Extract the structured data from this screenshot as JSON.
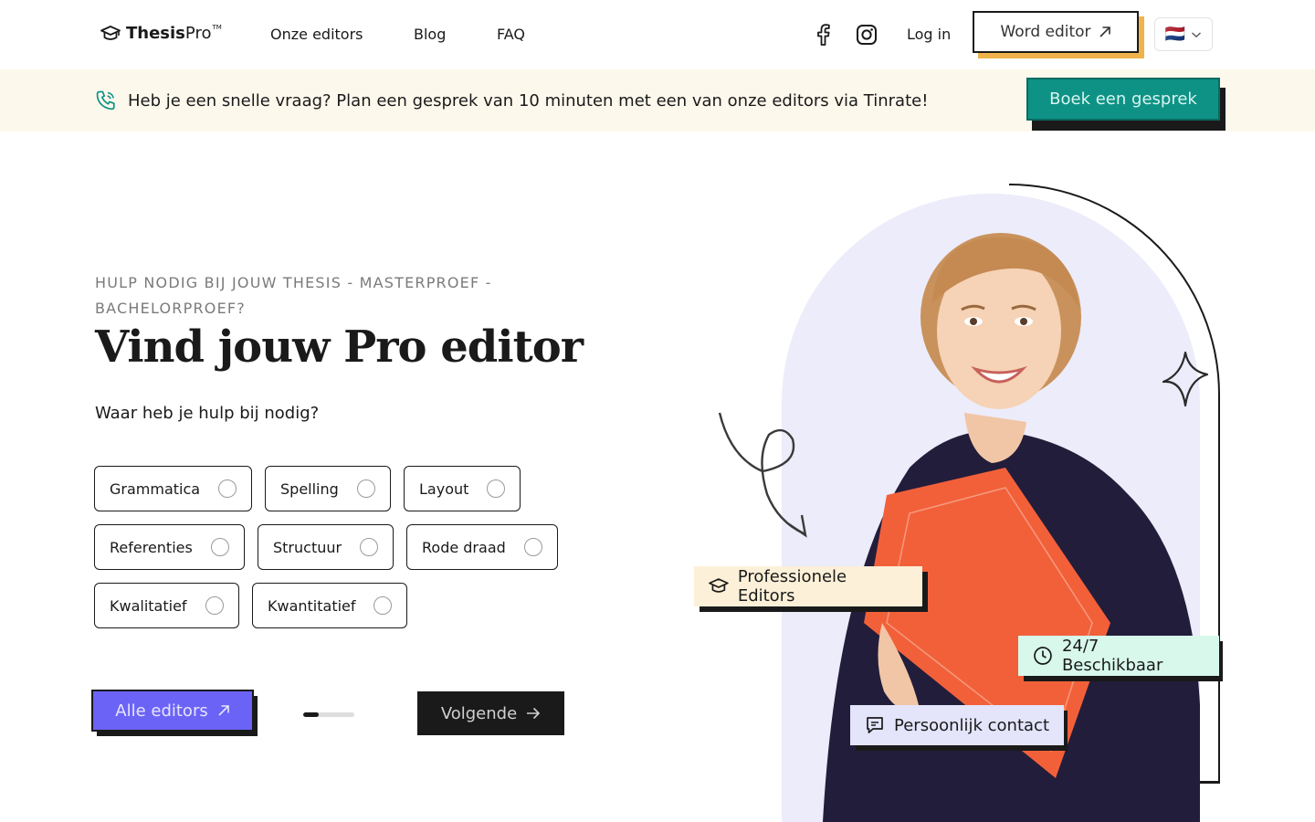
{
  "header": {
    "logo": {
      "brand_bold": "Thesis",
      "brand_light": "Pro",
      "trademark": "TM",
      "icon": "graduation-cap-icon"
    },
    "nav": [
      "Onze editors",
      "Blog",
      "FAQ"
    ],
    "social": [
      "facebook-icon",
      "instagram-icon"
    ],
    "login_label": "Log in",
    "word_editor_label": "Word editor",
    "language_flag": "🇳🇱"
  },
  "banner": {
    "icon": "phone-icon",
    "text": "Heb je een snelle vraag? Plan een gesprek van 10 minuten met een van onze editors via Tinrate!",
    "button_label": "Boek een gesprek"
  },
  "hero": {
    "eyebrow": "HULP NODIG BIJ JOUW THESIS - MASTERPROEF - BACHELORPROEF?",
    "title": "Vind jouw Pro editor",
    "question": "Waar heb je hulp bij nodig?",
    "options": [
      "Grammatica",
      "Spelling",
      "Layout",
      "Referenties",
      "Structuur",
      "Rode draad",
      "Kwalitatief",
      "Kwantitatief"
    ],
    "all_editors_label": "Alle editors",
    "next_label": "Volgende",
    "step_progress": 0.3
  },
  "badges": {
    "professional": "Professionele Editors",
    "available": "24/7 Beschikbaar",
    "contact": "Persoonlijk contact"
  },
  "colors": {
    "banner_bg": "#fdf8ec",
    "teal": "#0e9285",
    "purple": "#6b63f6",
    "orange_shadow": "#f0b24a",
    "arch_bg": "#ececfa",
    "book_orange": "#f2603a"
  }
}
